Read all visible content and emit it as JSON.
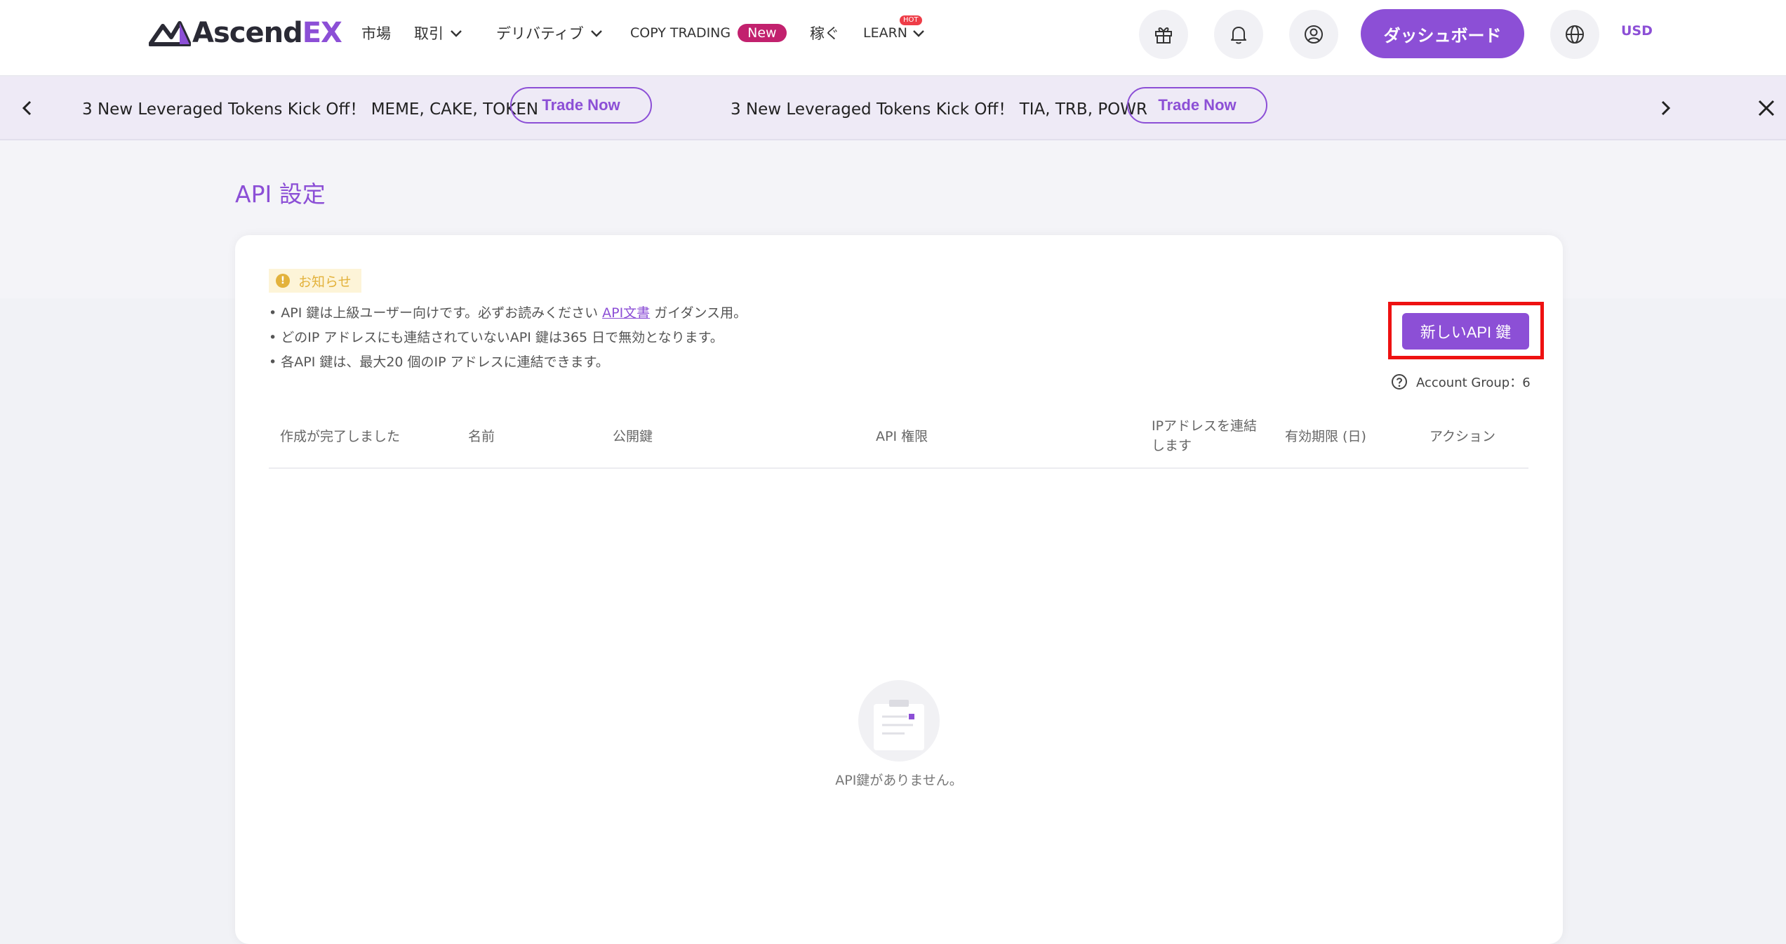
{
  "header": {
    "logo_main": "Ascend",
    "logo_accent": "EX",
    "nav": {
      "market": "市場",
      "trade": "取引",
      "derivatives": "デリバティブ",
      "copy_trading": "COPY TRADING",
      "copy_trading_badge": "New",
      "earn": "稼ぐ",
      "learn": "LEARN",
      "learn_badge": "HOT"
    },
    "dashboard_label": "ダッシュボード",
    "currency": "USD"
  },
  "banner": {
    "item1_text": "3 New Leveraged Tokens Kick Off！ MEME, CAKE, TOKEN",
    "item1_button": "Trade Now",
    "item2_text": "3 New Leveraged Tokens Kick Off！ TIA, TRB, POWR",
    "item2_button": "Trade Now"
  },
  "page": {
    "title": "API 設定"
  },
  "notice": {
    "tag": "お知らせ",
    "line1_pre": "• API 鍵は上級ユーザー向けです。必ずお読みください ",
    "line1_link": "API文書",
    "line1_post": " ガイダンス用。",
    "line2": "• どのIP アドレスにも連結されていないAPI 鍵は365 日で無効となります。",
    "line3": "• 各API 鍵は、最大20 個のIP アドレスに連結できます。"
  },
  "actions": {
    "new_key_button": "新しいAPI 鍵",
    "account_group": "Account Group：6"
  },
  "table": {
    "columns": [
      "作成が完了しました",
      "名前",
      "公開鍵",
      "API 権限",
      "IPアドレスを連結します",
      "有効期限 (日)",
      "アクション"
    ],
    "empty_text": "API鍵がありません。"
  }
}
